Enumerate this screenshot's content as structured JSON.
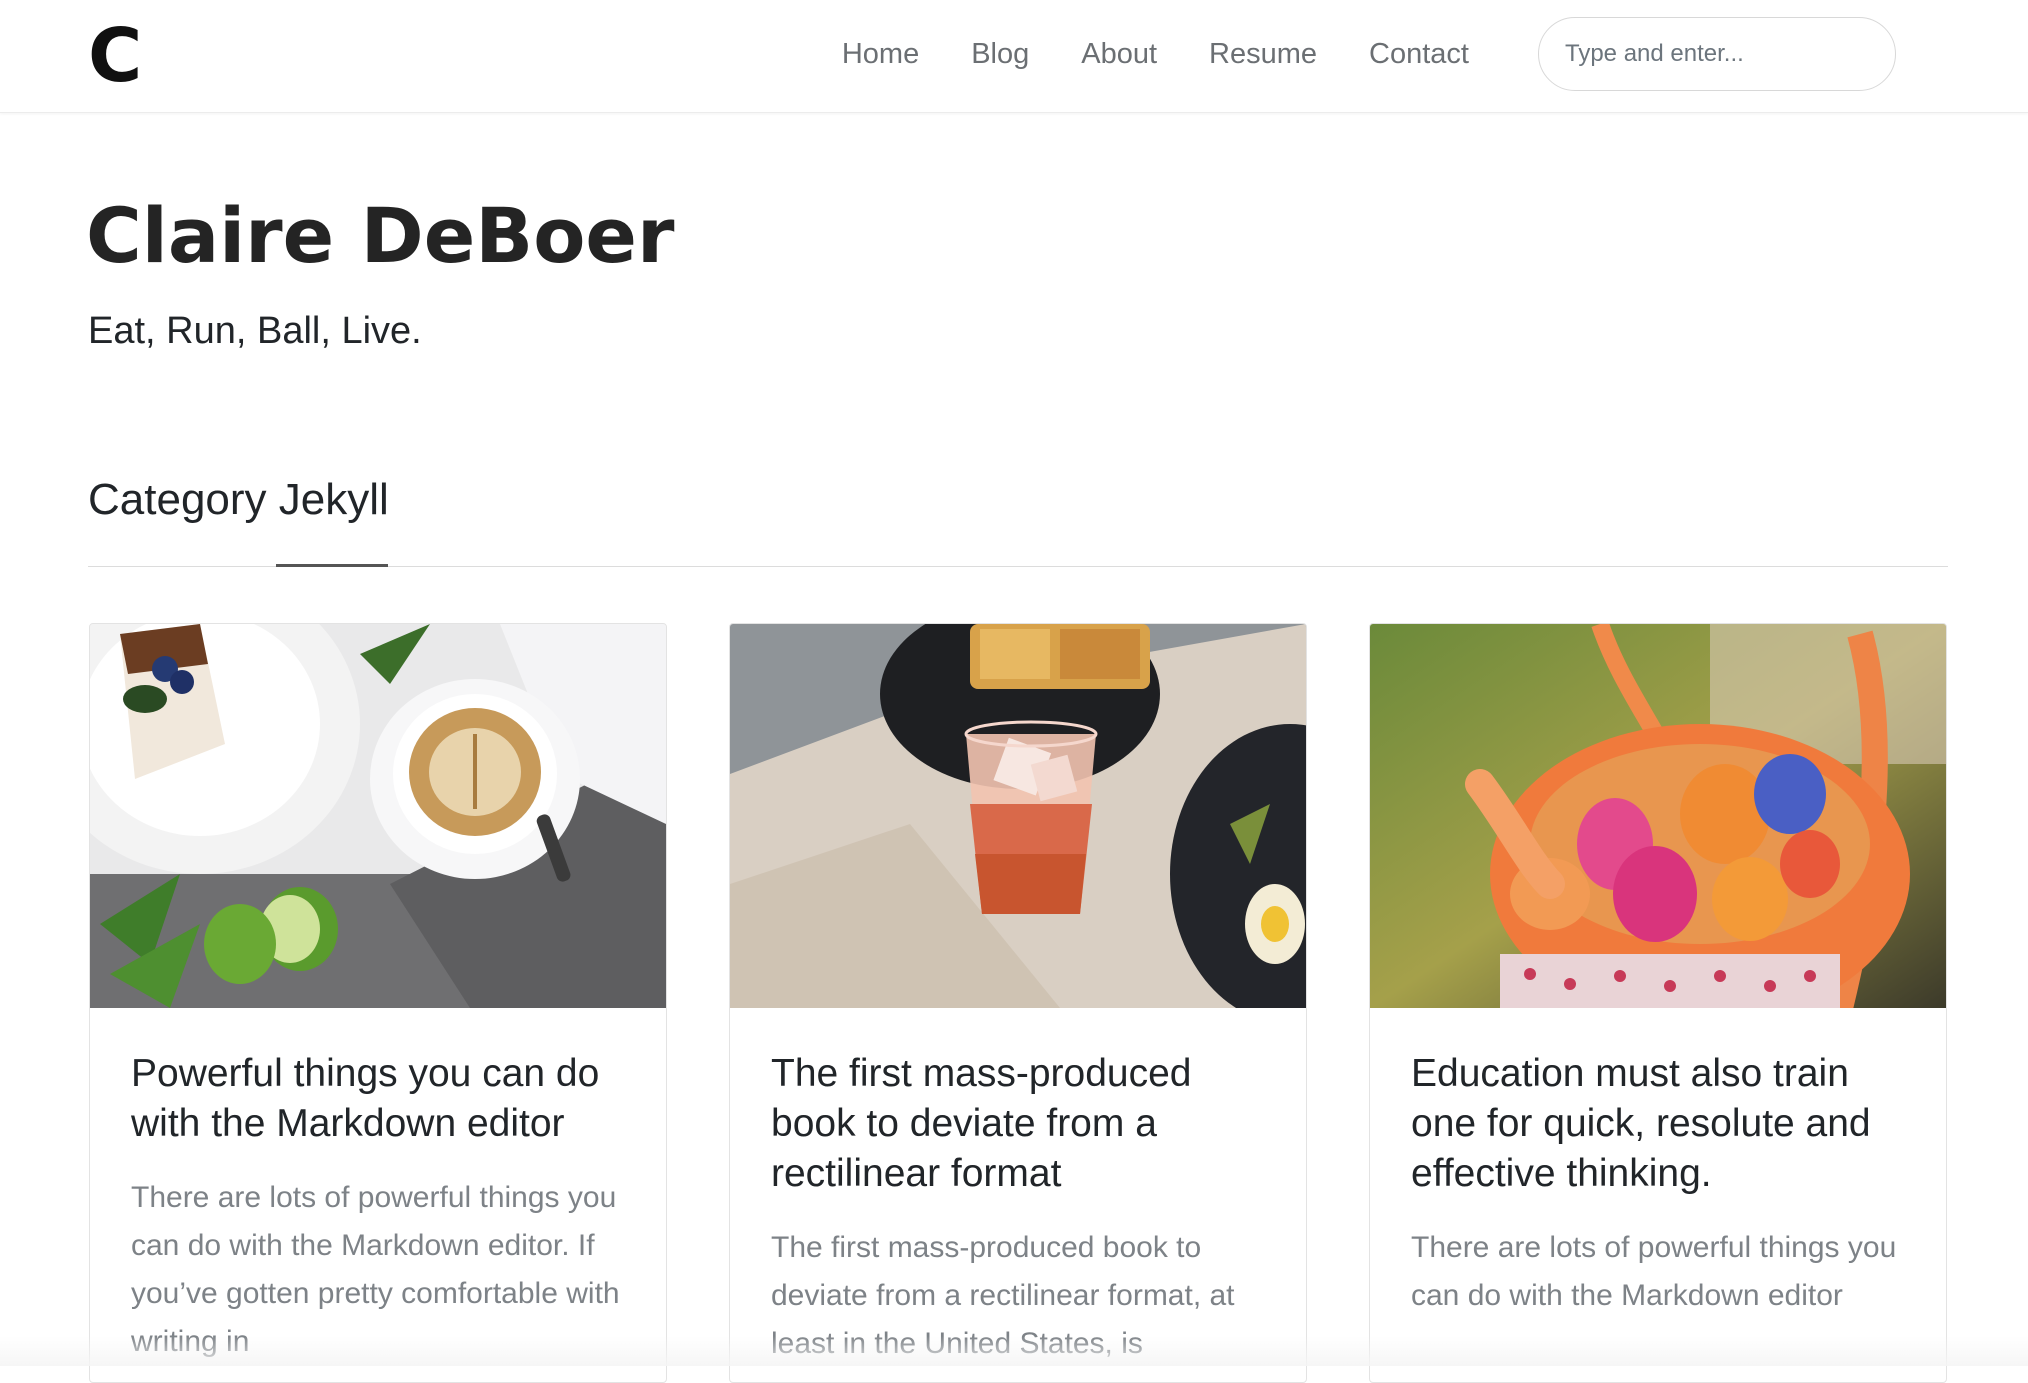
{
  "navbar": {
    "logo": "C",
    "links": [
      "Home",
      "Blog",
      "About",
      "Resume",
      "Contact"
    ],
    "search_placeholder": "Type and enter..."
  },
  "header": {
    "title": "Claire DeBoer",
    "tagline": "Eat, Run, Ball, Live."
  },
  "section": {
    "heading": "Category Jekyll"
  },
  "cards": [
    {
      "title": "Powerful things you can do with the Markdown editor",
      "excerpt": "There are lots of powerful things you can do with the Markdown editor. If you’ve gotten pretty comfortable with writing in",
      "image": "coffee-and-cake-photo"
    },
    {
      "title": "The first mass-produced book to deviate from a rectilinear format",
      "excerpt": "The first mass-produced book to deviate from a rectilinear format, at least in the United States, is",
      "image": "cocktail-and-food-photo"
    },
    {
      "title": "Education must also train one for quick, resolute and effective thinking.",
      "excerpt": "There are lots of powerful things you can do with the Markdown editor",
      "image": "easter-basket-photo"
    }
  ]
}
